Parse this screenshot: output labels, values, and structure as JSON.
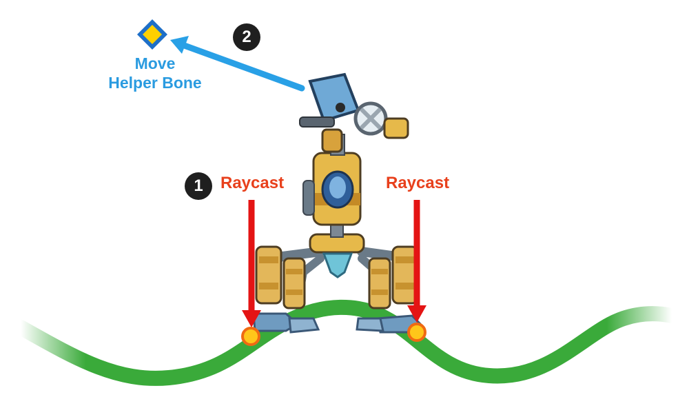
{
  "steps": {
    "one": "1",
    "two": "2"
  },
  "labels": {
    "raycast_left": "Raycast",
    "raycast_right": "Raycast",
    "helper_line1": "Move",
    "helper_line2": "Helper Bone"
  },
  "colors": {
    "ground": "#3aaa3a",
    "ray": "#e41414",
    "raycast_text": "#e8401c",
    "helper_text": "#2a9be0",
    "helper_arrow": "#29a0e6",
    "hit_point": "#ffc61a",
    "hit_outline": "#f06a12",
    "diamond_outer": "#1e6fc8",
    "diamond_inner": "#ffd000",
    "badge": "#1f1f1f"
  },
  "icons": {
    "step_badge": "numbered-circle",
    "helper_bone": "diamond-icon",
    "raycast": "down-arrow",
    "hit": "circle-dot",
    "character": "robot-walker"
  }
}
